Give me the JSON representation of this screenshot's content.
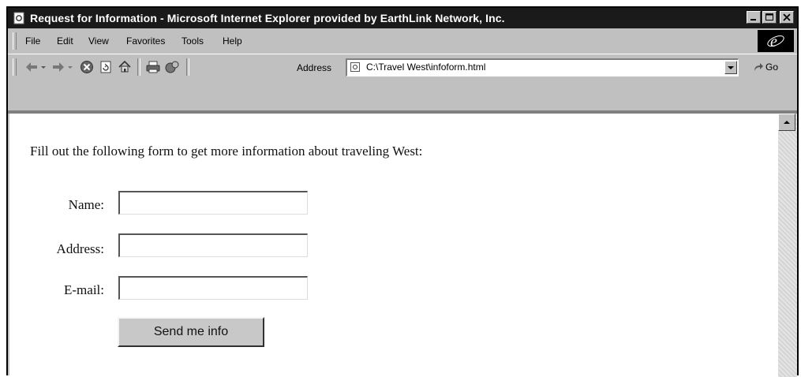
{
  "window": {
    "title": "Request for Information - Microsoft Internet Explorer provided by EarthLink Network, Inc."
  },
  "menu": {
    "items": [
      {
        "label": "File"
      },
      {
        "label": "Edit"
      },
      {
        "label": "View"
      },
      {
        "label": "Favorites"
      },
      {
        "label": "Tools"
      },
      {
        "label": "Help"
      }
    ]
  },
  "toolbar": {
    "address_label": "Address",
    "url": "C:\\Travel West\\infoform.html",
    "go_label": "Go"
  },
  "page": {
    "intro": "Fill out the following form to get more information about traveling West:",
    "fields": [
      {
        "label": "Name:",
        "value": ""
      },
      {
        "label": "Address:",
        "value": ""
      },
      {
        "label": "E-mail:",
        "value": ""
      }
    ],
    "submit_label": "Send me info"
  }
}
